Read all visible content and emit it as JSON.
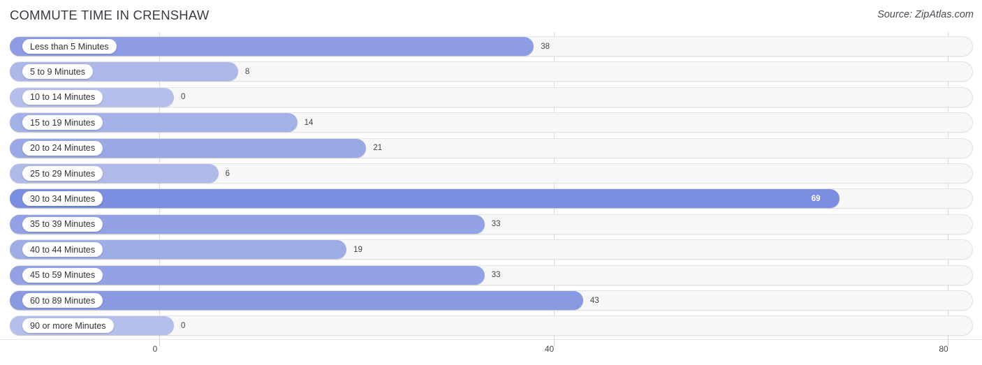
{
  "header": {
    "title": "COMMUTE TIME IN CRENSHAW",
    "source": "Source: ZipAtlas.com"
  },
  "chart_data": {
    "type": "bar",
    "orientation": "horizontal",
    "title": "COMMUTE TIME IN CRENSHAW",
    "source": "Source: ZipAtlas.com",
    "xlabel": "",
    "ylabel": "",
    "xlim": [
      0,
      80
    ],
    "grid": true,
    "legend": false,
    "xticks": [
      0,
      40,
      80
    ],
    "xtick_labels": [
      "0",
      "40",
      "80"
    ],
    "categories": [
      "Less than 5 Minutes",
      "5 to 9 Minutes",
      "10 to 14 Minutes",
      "15 to 19 Minutes",
      "20 to 24 Minutes",
      "25 to 29 Minutes",
      "30 to 34 Minutes",
      "35 to 39 Minutes",
      "40 to 44 Minutes",
      "45 to 59 Minutes",
      "60 to 89 Minutes",
      "90 or more Minutes"
    ],
    "values": [
      38,
      8,
      0,
      14,
      21,
      6,
      69,
      33,
      19,
      33,
      43,
      0
    ],
    "value_labels": [
      "38",
      "8",
      "0",
      "14",
      "21",
      "6",
      "69",
      "33",
      "19",
      "33",
      "43",
      "0"
    ],
    "bar_colors": [
      "#8e9de3",
      "#adb8e9",
      "#b5bfeb",
      "#a4b1e7",
      "#9aa8e5",
      "#b0bae9",
      "#7b8ee0",
      "#93a2e4",
      "#9fade6",
      "#93a2e4",
      "#8a9ae2",
      "#b5bfeb"
    ],
    "track_color": "#f7f7f8",
    "accent_color": "#8e9de3"
  }
}
